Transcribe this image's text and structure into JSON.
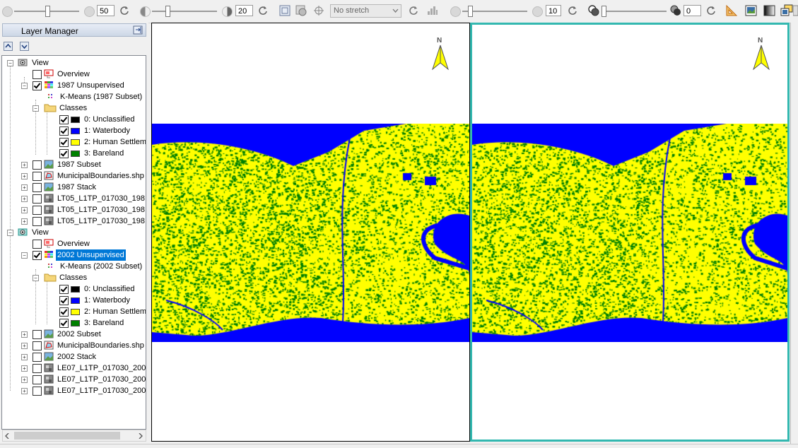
{
  "toolbar": {
    "brightness_value": "50",
    "contrast_value": "20",
    "stretch_select": "No stretch",
    "sharpen_value": "10",
    "transparency_value": "0"
  },
  "layer_manager": {
    "title": "Layer Manager",
    "views": [
      {
        "label": "View",
        "items": [
          {
            "label": "Overview"
          },
          {
            "label": "1987 Unsupervised"
          },
          {
            "label": "K-Means (1987 Subset)"
          },
          {
            "label": "Classes"
          },
          {
            "label": "0: Unclassified"
          },
          {
            "label": "1: Waterbody"
          },
          {
            "label": "2: Human Settleme"
          },
          {
            "label": "3: Bareland"
          },
          {
            "label": "1987 Subset"
          },
          {
            "label": "MunicipalBoundaries.shp ["
          },
          {
            "label": "1987 Stack"
          },
          {
            "label": "LT05_L1TP_017030_198"
          },
          {
            "label": "LT05_L1TP_017030_198"
          },
          {
            "label": "LT05_L1TP_017030_198"
          }
        ]
      },
      {
        "label": "View",
        "items": [
          {
            "label": "Overview"
          },
          {
            "label": "2002 Unsupervised"
          },
          {
            "label": "K-Means (2002 Subset)"
          },
          {
            "label": "Classes"
          },
          {
            "label": "0: Unclassified"
          },
          {
            "label": "1: Waterbody"
          },
          {
            "label": "2: Human Settleme"
          },
          {
            "label": "3: Bareland"
          },
          {
            "label": "2002 Subset"
          },
          {
            "label": "MunicipalBoundaries.shp ["
          },
          {
            "label": "2002 Stack"
          },
          {
            "label": "LE07_L1TP_017030_200"
          },
          {
            "label": "LE07_L1TP_017030_200"
          },
          {
            "label": "LE07_L1TP_017030_200"
          }
        ]
      }
    ]
  },
  "map_views": {
    "north_arrow_letter": "N"
  },
  "colors": {
    "unclassified": "#000000",
    "waterbody": "#0000ff",
    "human_settlement": "#ffff00",
    "bareland": "#008000",
    "active_view_border": "#33b8b0",
    "selection": "#0078d7"
  }
}
